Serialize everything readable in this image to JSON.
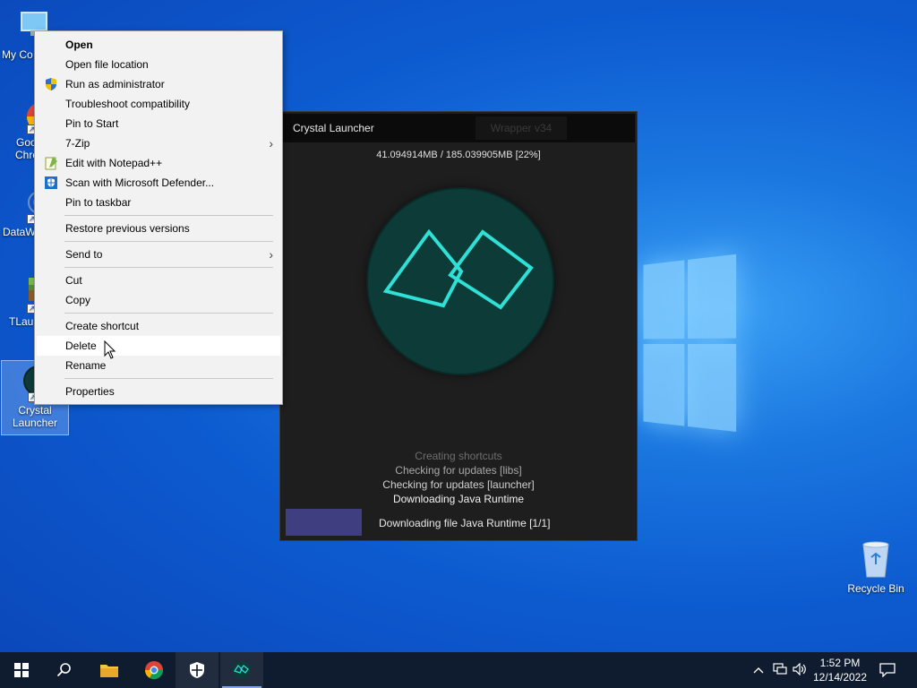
{
  "desktop": {
    "icons": [
      {
        "label": "My Co"
      },
      {
        "label": "Goo",
        "label2": "Chro"
      },
      {
        "label": "DataW"
      },
      {
        "label": "TLau"
      },
      {
        "label": "Crystal",
        "label2": "Launcher"
      }
    ],
    "recycle_bin": "Recycle Bin"
  },
  "context_menu": {
    "items": [
      {
        "label": "Open"
      },
      {
        "label": "Open file location"
      },
      {
        "label": "Run as administrator"
      },
      {
        "label": "Troubleshoot compatibility"
      },
      {
        "label": "Pin to Start"
      },
      {
        "label": "7-Zip"
      },
      {
        "label": "Edit with Notepad++"
      },
      {
        "label": "Scan with Microsoft Defender..."
      },
      {
        "label": "Pin to taskbar"
      },
      {
        "label": "Restore previous versions"
      },
      {
        "label": "Send to"
      },
      {
        "label": "Cut"
      },
      {
        "label": "Copy"
      },
      {
        "label": "Create shortcut"
      },
      {
        "label": "Delete"
      },
      {
        "label": "Rename"
      },
      {
        "label": "Properties"
      }
    ],
    "arrow_glyph": "›"
  },
  "launcher": {
    "title": "Crystal Launcher",
    "wrapper": "Wrapper v34",
    "download_size": "41.094914MB / 185.039905MB [22%]",
    "status_lines": [
      {
        "text": "Creating shortcuts",
        "color": "#6e6e6e"
      },
      {
        "text": "Checking for updates [libs]",
        "color": "#a8a8a8"
      },
      {
        "text": "Checking for updates [launcher]",
        "color": "#d0d0d0"
      },
      {
        "text": "Downloading Java Runtime",
        "color": "#f2f2f2"
      }
    ],
    "progress_label": "Downloading file Java Runtime [1/1]",
    "accent_color": "#2ee0d6"
  },
  "taskbar": {
    "time": "1:52 PM",
    "date": "12/14/2022"
  }
}
